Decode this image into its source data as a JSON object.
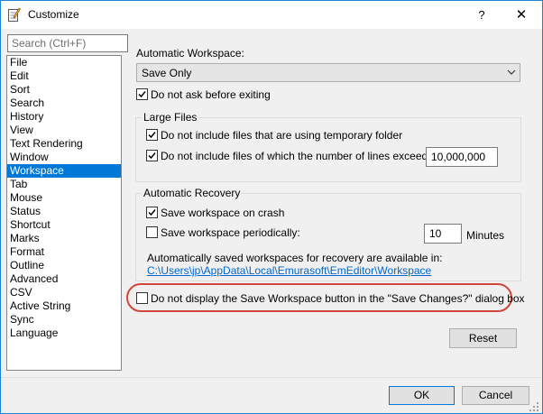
{
  "window": {
    "title": "Customize",
    "help_glyph": "?",
    "close_glyph": "✕"
  },
  "search": {
    "placeholder": "Search (Ctrl+F)"
  },
  "categories": [
    {
      "label": "File"
    },
    {
      "label": "Edit"
    },
    {
      "label": "Sort"
    },
    {
      "label": "Search"
    },
    {
      "label": "History"
    },
    {
      "label": "View"
    },
    {
      "label": "Text Rendering"
    },
    {
      "label": "Window"
    },
    {
      "label": "Workspace",
      "selected": true
    },
    {
      "label": "Tab"
    },
    {
      "label": "Mouse"
    },
    {
      "label": "Status"
    },
    {
      "label": "Shortcut"
    },
    {
      "label": "Marks"
    },
    {
      "label": "Format"
    },
    {
      "label": "Outline"
    },
    {
      "label": "Advanced"
    },
    {
      "label": "CSV"
    },
    {
      "label": "Active String"
    },
    {
      "label": "Sync"
    },
    {
      "label": "Language"
    }
  ],
  "workspace": {
    "auto_label": "Automatic Workspace:",
    "auto_value": "Save Only",
    "do_not_ask_label": "Do not ask before exiting",
    "do_not_ask_checked": true
  },
  "large_files": {
    "group_label": "Large Files",
    "temp_folder_label": "Do not include files that are using temporary folder",
    "temp_folder_checked": true,
    "lines_label": "Do not include files of which the number of lines exceed:",
    "lines_checked": true,
    "lines_value": "10,000,000"
  },
  "recovery": {
    "group_label": "Automatic Recovery",
    "on_crash_label": "Save workspace on crash",
    "on_crash_checked": true,
    "periodic_label": "Save workspace periodically:",
    "periodic_checked": false,
    "minutes_value": "10",
    "minutes_unit": "Minutes",
    "info_text": "Automatically saved workspaces for recovery are available in:",
    "path_link": "C:\\Users\\jp\\AppData\\Local\\Emurasoft\\EmEditor\\Workspace"
  },
  "save_button_option": {
    "label": "Do not display the Save Workspace button in the \"Save Changes?\" dialog box",
    "checked": false
  },
  "buttons": {
    "reset": "Reset",
    "ok": "OK",
    "cancel": "Cancel"
  },
  "colors": {
    "accent": "#0078d7",
    "callout": "#d0453c",
    "link": "#0066cc"
  }
}
